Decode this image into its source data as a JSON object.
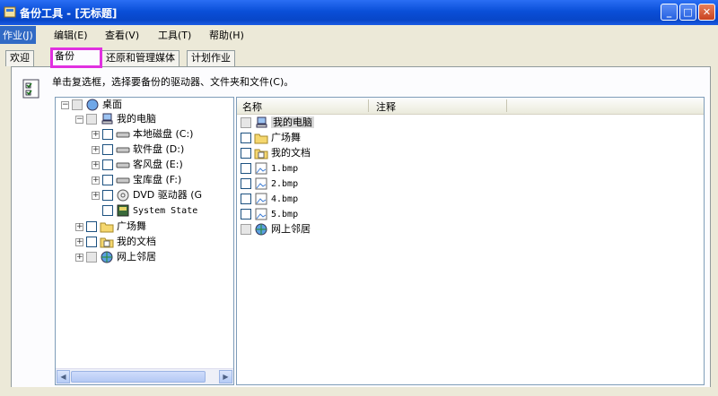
{
  "window": {
    "title": "备份工具 - [无标题]",
    "buttons": {
      "minimize": "_",
      "maximize": "□",
      "close": "✕"
    }
  },
  "menu": [
    "作业(J)",
    "编辑(E)",
    "查看(V)",
    "工具(T)",
    "帮助(H)"
  ],
  "tabs": [
    "欢迎",
    "备份",
    "还原和管理媒体",
    "计划作业"
  ],
  "selected_tab": "备份",
  "instruction": "单击复选框，选择要备份的驱动器、文件夹和文件(C)。",
  "tree": {
    "desktop": "桌面",
    "my_computer": "我的电脑",
    "drives": [
      "本地磁盘 (C:)",
      "软件盘 (D:)",
      "客风盘 (E:)",
      "宝库盘 (F:)",
      "DVD 驱动器 (G"
    ],
    "system_state": "System State",
    "others": [
      "广场舞",
      "我的文档",
      "网上邻居"
    ]
  },
  "list": {
    "columns": [
      "名称",
      "注释"
    ],
    "items": [
      "我的电脑",
      "广场舞",
      "我的文档",
      "1.bmp",
      "2.bmp",
      "4.bmp",
      "5.bmp",
      "网上邻居"
    ]
  },
  "icons": {
    "app": "backup-icon",
    "computer": "computer-icon",
    "drive": "drive-icon",
    "folder": "folder-icon",
    "docs": "documents-icon",
    "bmp": "image-file-icon",
    "network": "network-icon",
    "dvd": "dvd-icon",
    "system_state": "system-state-icon"
  },
  "colors": {
    "titlebar": "#0a4fd8",
    "highlight": "#e030e0",
    "menu_active": "#316ac5"
  }
}
